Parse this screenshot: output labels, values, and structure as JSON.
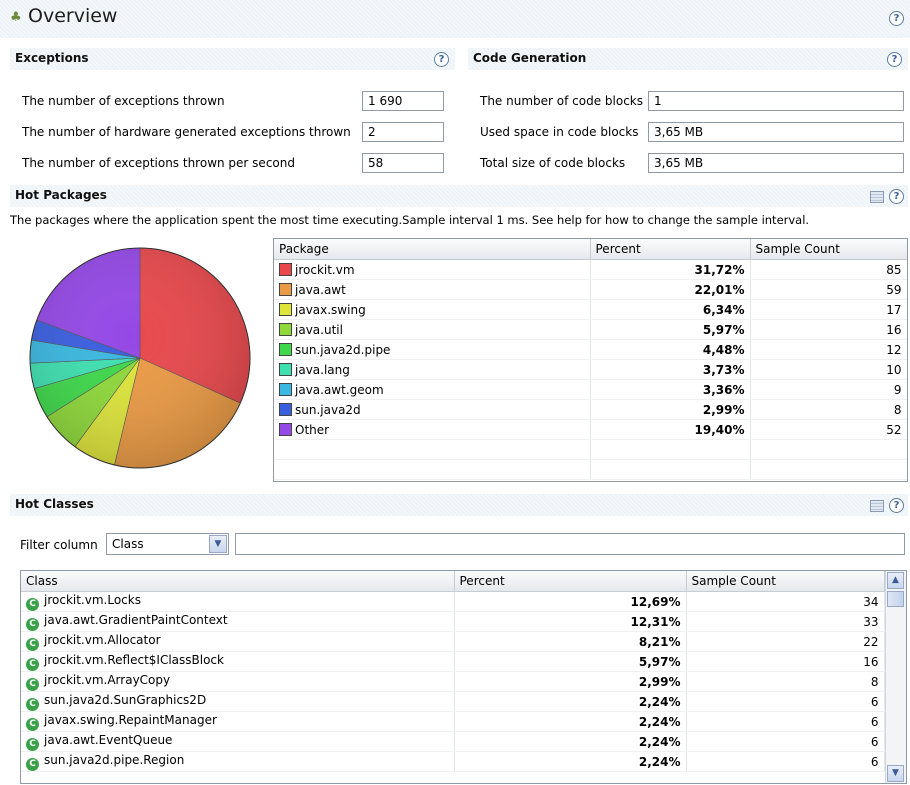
{
  "page": {
    "title": "Overview",
    "icon": "overview-icon",
    "help_icon": "help-icon"
  },
  "exceptions": {
    "title": "Exceptions",
    "rows": [
      {
        "label": "The number of exceptions thrown",
        "value": "1 690"
      },
      {
        "label": "The number of hardware generated exceptions thrown",
        "value": "2"
      },
      {
        "label": "The number of exceptions thrown per second",
        "value": "58"
      }
    ]
  },
  "code_generation": {
    "title": "Code Generation",
    "rows": [
      {
        "label": "The number of code blocks",
        "value": "1"
      },
      {
        "label": "Used space in code blocks",
        "value": "3,65 MB"
      },
      {
        "label": "Total size of code blocks",
        "value": "3,65 MB"
      }
    ]
  },
  "hot_packages": {
    "title": "Hot Packages",
    "description": "The packages where the application spent the most time executing.Sample interval 1 ms. See help for how to change the sample interval.",
    "columns": [
      "Package",
      "Percent",
      "Sample Count"
    ],
    "rows": [
      {
        "name": "jrockit.vm",
        "percent": "31,72%",
        "count": "85",
        "color": "#e8484c"
      },
      {
        "name": "java.awt",
        "percent": "22,01%",
        "count": "59",
        "color": "#ea9a44"
      },
      {
        "name": "javax.swing",
        "percent": "6,34%",
        "count": "17",
        "color": "#dde43a"
      },
      {
        "name": "java.util",
        "percent": "5,97%",
        "count": "16",
        "color": "#8ed83a"
      },
      {
        "name": "sun.java2d.pipe",
        "percent": "4,48%",
        "count": "12",
        "color": "#3ed84a"
      },
      {
        "name": "java.lang",
        "percent": "3,73%",
        "count": "10",
        "color": "#3ee0b0"
      },
      {
        "name": "java.awt.geom",
        "percent": "3,36%",
        "count": "9",
        "color": "#3ab8e0"
      },
      {
        "name": "sun.java2d",
        "percent": "2,99%",
        "count": "8",
        "color": "#3a5ee0"
      },
      {
        "name": "Other",
        "percent": "19,40%",
        "count": "52",
        "color": "#9448e6"
      }
    ]
  },
  "hot_classes": {
    "title": "Hot Classes",
    "filter_label": "Filter column",
    "filter_selected": "Class",
    "filter_text": "",
    "columns": [
      "Class",
      "Percent",
      "Sample Count"
    ],
    "rows": [
      {
        "name": "jrockit.vm.Locks",
        "percent": "12,69%",
        "count": "34"
      },
      {
        "name": "java.awt.GradientPaintContext",
        "percent": "12,31%",
        "count": "33"
      },
      {
        "name": "jrockit.vm.Allocator",
        "percent": "8,21%",
        "count": "22"
      },
      {
        "name": "jrockit.vm.Reflect$IClassBlock",
        "percent": "5,97%",
        "count": "16"
      },
      {
        "name": "jrockit.vm.ArrayCopy",
        "percent": "2,99%",
        "count": "8"
      },
      {
        "name": "sun.java2d.SunGraphics2D",
        "percent": "2,24%",
        "count": "6"
      },
      {
        "name": "javax.swing.RepaintManager",
        "percent": "2,24%",
        "count": "6"
      },
      {
        "name": "java.awt.EventQueue",
        "percent": "2,24%",
        "count": "6"
      },
      {
        "name": "sun.java2d.pipe.Region",
        "percent": "2,24%",
        "count": "6"
      }
    ]
  },
  "chart_data": {
    "type": "pie",
    "categories": [
      "jrockit.vm",
      "java.awt",
      "javax.swing",
      "java.util",
      "sun.java2d.pipe",
      "java.lang",
      "java.awt.geom",
      "sun.java2d",
      "Other"
    ],
    "values": [
      31.72,
      22.01,
      6.34,
      5.97,
      4.48,
      3.73,
      3.36,
      2.99,
      19.4
    ],
    "colors": [
      "#e8484c",
      "#ea9a44",
      "#dde43a",
      "#8ed83a",
      "#3ed84a",
      "#3ee0b0",
      "#3ab8e0",
      "#3a5ee0",
      "#9448e6"
    ],
    "title": ""
  }
}
